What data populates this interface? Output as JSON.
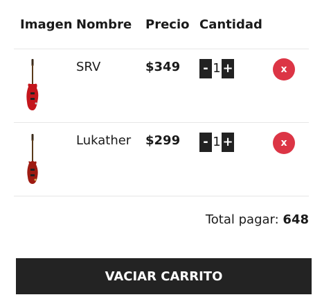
{
  "table": {
    "headers": [
      "Imagen",
      "Nombre",
      "Precio",
      "Cantidad"
    ],
    "rows": [
      {
        "name": "SRV",
        "price": "$349",
        "qty": "1",
        "dec": "-",
        "inc": "+",
        "remove": "x",
        "guitar_color": "#c4161c"
      },
      {
        "name": "Lukather",
        "price": "$299",
        "qty": "1",
        "dec": "-",
        "inc": "+",
        "remove": "x",
        "guitar_color": "#9e1b12"
      }
    ]
  },
  "total": {
    "label": "Total pagar:",
    "value": "648"
  },
  "actions": {
    "empty_cart": "VACIAR CARRITO"
  },
  "colors": {
    "remove": "#dc3545",
    "button_dark": "#232323"
  }
}
